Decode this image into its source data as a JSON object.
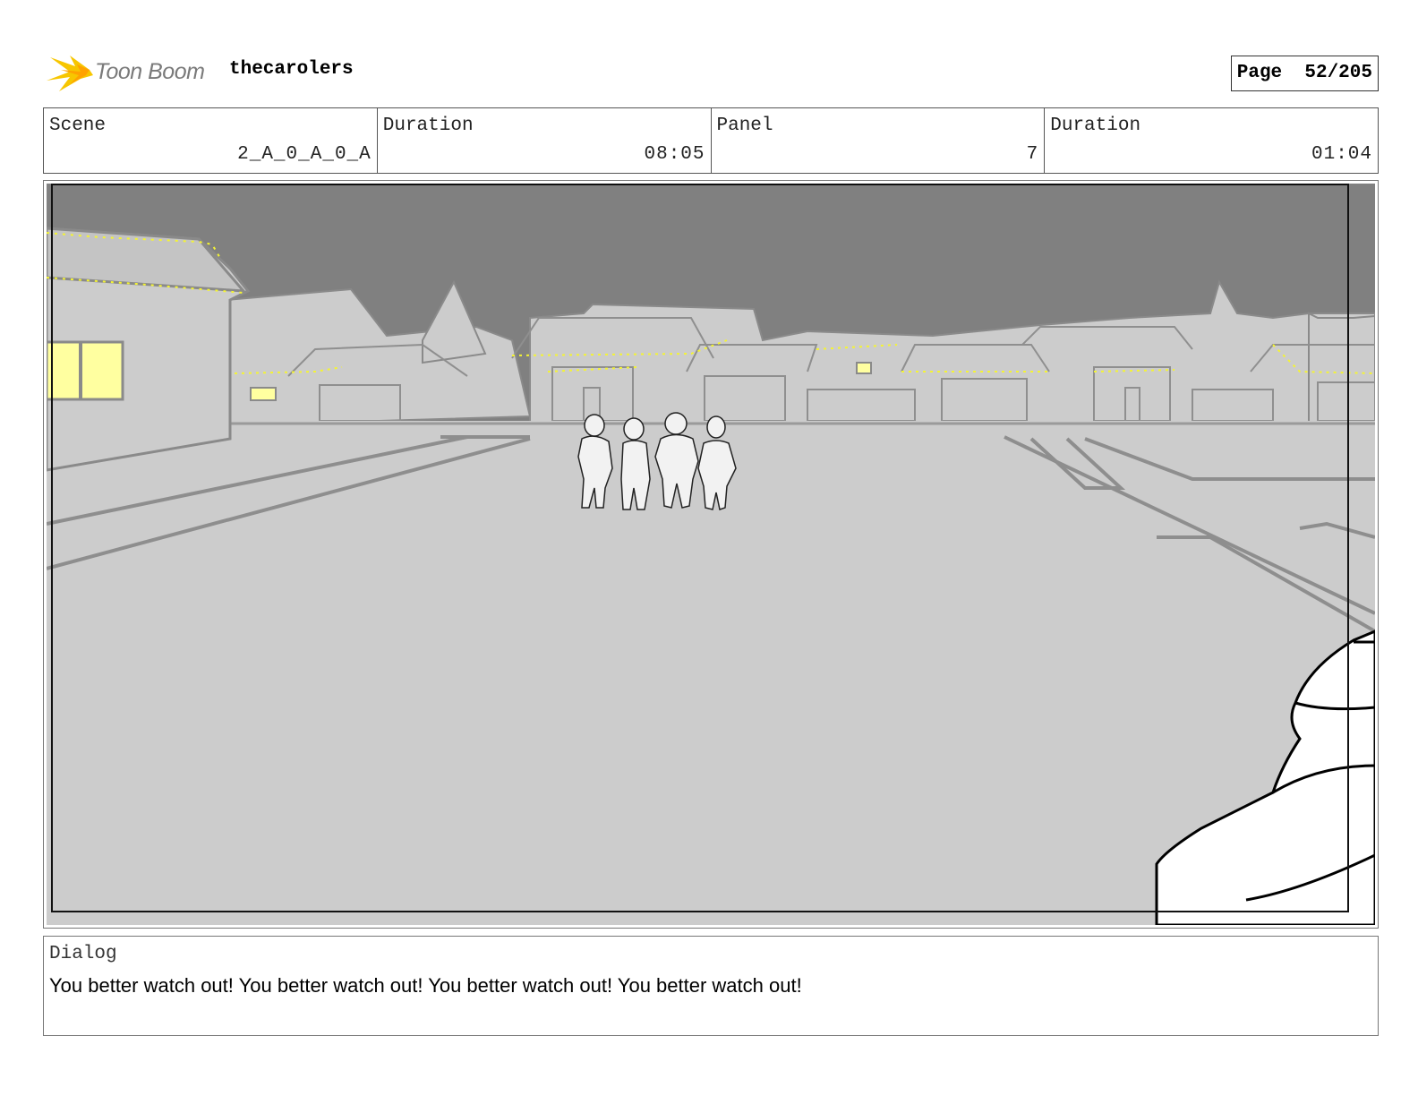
{
  "header": {
    "logo_text": "Toon Boom",
    "project_name": "thecarolers",
    "page_label": "Page",
    "page_number": "52/205"
  },
  "info": {
    "scene_label": "Scene",
    "scene_value": "2_A_0_A_0_A",
    "scene_duration_label": "Duration",
    "scene_duration_value": "08:05",
    "panel_label": "Panel",
    "panel_value": "7",
    "panel_duration_label": "Duration",
    "panel_duration_value": "01:04"
  },
  "dialog": {
    "label": "Dialog",
    "text": "You better watch out! You better watch out! You better watch out! You better watch out!"
  },
  "colors": {
    "sky": "#808080",
    "ground": "#cccccc",
    "window_glow": "#ffffa0",
    "lights": "#f4f433",
    "logo_star": "#f7c600"
  }
}
